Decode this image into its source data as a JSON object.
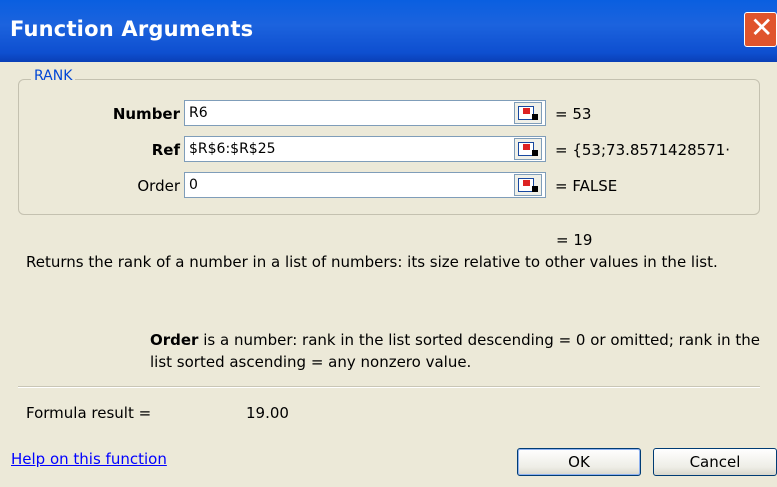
{
  "window": {
    "title": "Function Arguments"
  },
  "group": {
    "label": "RANK"
  },
  "args": [
    {
      "label": "Number",
      "bold": true,
      "value": "R6",
      "result": "= 53"
    },
    {
      "label": "Ref",
      "bold": true,
      "value": "$R$6:$R$25",
      "result": "= {53;73.8571428571·"
    },
    {
      "label": "Order",
      "bold": false,
      "value": "0",
      "result": "= FALSE"
    }
  ],
  "function_result": "= 19",
  "description": "Returns the rank of a number in a list of numbers: its size relative to other values in the list.",
  "arg_help": {
    "name": "Order",
    "text": "is a number: rank in the list sorted descending = 0 or omitted; rank in the list sorted ascending = any nonzero value."
  },
  "formula": {
    "label": "Formula result =",
    "value": "19.00"
  },
  "help_link": "Help on this function",
  "buttons": {
    "ok": "OK",
    "cancel": "Cancel"
  },
  "icons": {
    "close": "close-icon",
    "collapse": "collapse-dialog-icon"
  }
}
